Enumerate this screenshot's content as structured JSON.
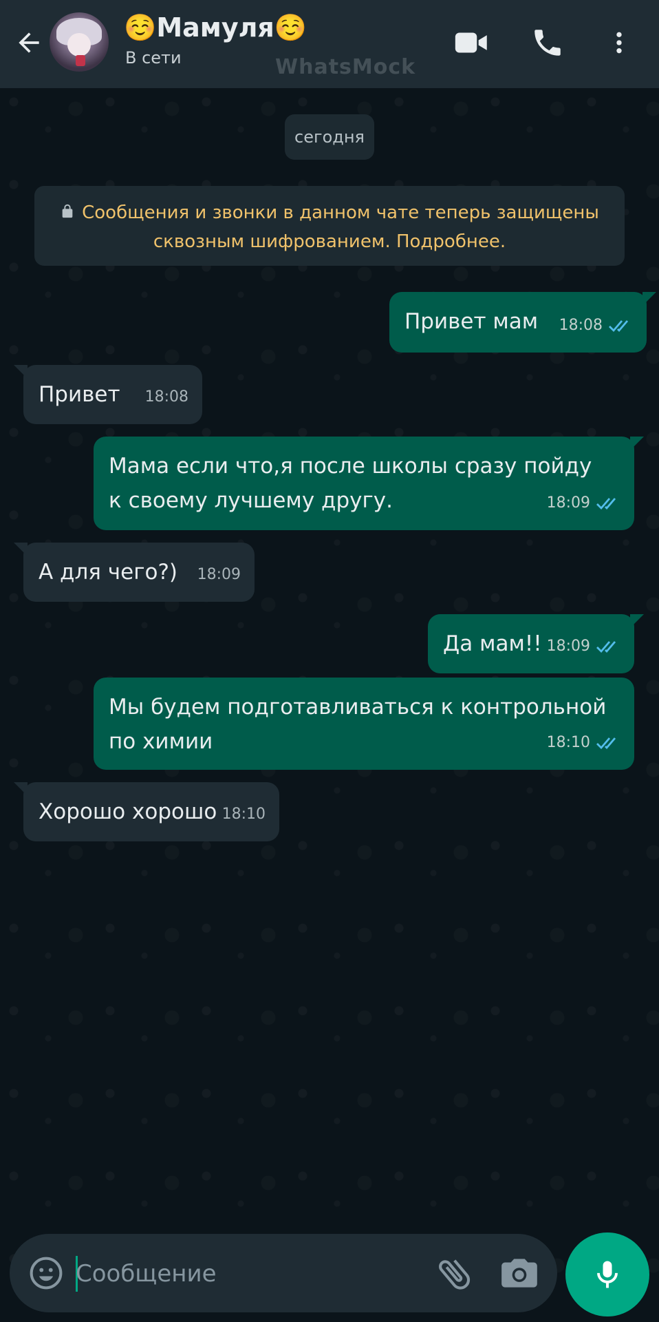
{
  "header": {
    "contact_name": "☺️Мамуля☺️",
    "status": "В сети",
    "watermark": "WhatsMock"
  },
  "chat": {
    "date_label": "сегодня",
    "encryption_notice": "Сообщения и звонки в данном чате теперь защищены сквозным шифрованием. Подробнее.",
    "messages": [
      {
        "direction": "out",
        "text": "Привет мам",
        "time": "18:08"
      },
      {
        "direction": "in",
        "text": "Привет",
        "time": "18:08"
      },
      {
        "direction": "out",
        "text": "Мама если что,я после школы сразу пойду к своему лучшему другу.",
        "time": "18:09"
      },
      {
        "direction": "in",
        "text": "А для чего?)",
        "time": "18:09"
      },
      {
        "direction": "out",
        "text": "Да мам!!",
        "time": "18:09"
      },
      {
        "direction": "out",
        "text": "Мы будем подготавливаться к контрольной по химии",
        "time": "18:10"
      },
      {
        "direction": "in",
        "text": "Хорошо хорошо",
        "time": "18:10"
      }
    ]
  },
  "composer": {
    "placeholder": "Сообщение"
  },
  "colors": {
    "header_bg": "#1f2c34",
    "outgoing_bubble": "#005c4b",
    "incoming_bubble": "#1f2c34",
    "accent": "#00a884",
    "read_ticks": "#53bdeb",
    "notice_text": "#f0c26b"
  },
  "icons": [
    "back-arrow-icon",
    "video-call-icon",
    "voice-call-icon",
    "more-options-icon",
    "lock-icon",
    "double-check-icon",
    "emoji-icon",
    "attach-icon",
    "camera-icon",
    "microphone-icon"
  ]
}
